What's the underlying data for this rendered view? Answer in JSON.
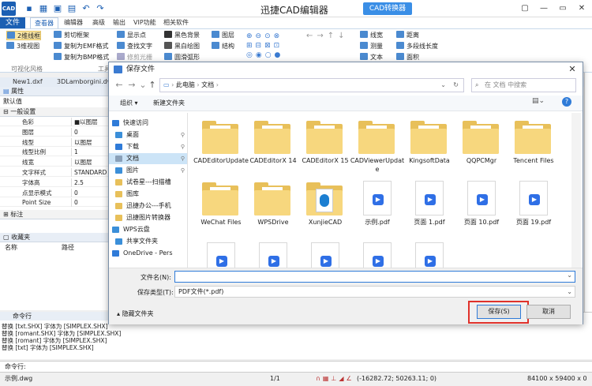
{
  "app": {
    "logo_text": "CAD",
    "title": "迅捷CAD编辑器",
    "convert_button": "CAD转换器",
    "window_controls": [
      "▢",
      "—",
      "▭",
      "✕"
    ]
  },
  "ribbon": {
    "tabs": [
      "文件",
      "查看器",
      "编辑器",
      "高级",
      "输出",
      "VIP功能",
      "相关软件"
    ],
    "active_tab": "查看器",
    "buttons": {
      "col1": [
        "2维线框",
        "3维视图"
      ],
      "col2": [
        "剪切框架",
        "复制为EMF格式",
        "复制为BMP格式"
      ],
      "col3": [
        "显示点",
        "查找文字",
        "修剪光栅"
      ],
      "col4": [
        "黑色背景",
        "黑白绘图",
        "圆滑弧形"
      ],
      "col5": [
        "图层",
        "结构"
      ],
      "col6": [
        "线宽",
        "测量",
        "文本"
      ],
      "col7": [
        "距离",
        "多段线长度",
        "面积"
      ]
    },
    "group_labels": [
      "可视化风格",
      "工具"
    ]
  },
  "doc_tabs": [
    "New1.dxf",
    "3DLamborgini.dwg"
  ],
  "properties": {
    "header": "属性",
    "default_value": "默认值",
    "section_general": "一般设置",
    "rows": [
      {
        "k": "色彩",
        "v": "■以图层"
      },
      {
        "k": "图层",
        "v": "0"
      },
      {
        "k": "线型",
        "v": "以图层"
      },
      {
        "k": "线型比例",
        "v": "1"
      },
      {
        "k": "线宽",
        "v": "以图层"
      },
      {
        "k": "文字样式",
        "v": "STANDARD"
      },
      {
        "k": "字体高",
        "v": "2.5"
      },
      {
        "k": "点显示模式",
        "v": "0"
      },
      {
        "k": "Point Size",
        "v": "0"
      }
    ],
    "section_annotation": "标注",
    "favorites_header": "收藏夹",
    "fav_cols": [
      "名称",
      "路径"
    ]
  },
  "command": {
    "header": "命令行",
    "lines": [
      "替换 [txt.SHX] 字体为 [SIMPLEX.SHX]",
      "替换 [romant.SHX] 字体为 [SIMPLEX.SHX]",
      "替换 [romant] 字体为 [SIMPLEX.SHX]",
      "替换 [txt] 字体为 [SIMPLEX.SHX]"
    ],
    "input_label": "命令行:"
  },
  "statusbar": {
    "file": "示例.dwg",
    "page": "1/1",
    "coords": "(-16282.72; 50263.11; 0)",
    "size": "84100 x 59400 x 0"
  },
  "dialog": {
    "title": "保存文件",
    "breadcrumb": [
      "此电脑",
      "文档"
    ],
    "search_placeholder": "在 文档 中搜索",
    "toolbar": {
      "organize": "组织 ▾",
      "new_folder": "新建文件夹"
    },
    "nav": [
      {
        "label": "快速访问",
        "icon": "star-icon",
        "color": "#2f7bd8",
        "indent": 0
      },
      {
        "label": "桌面",
        "icon": "desktop-icon",
        "color": "#3b8fd9",
        "indent": 1,
        "pin": true
      },
      {
        "label": "下载",
        "icon": "download-icon",
        "color": "#2f7bd8",
        "indent": 1,
        "pin": true
      },
      {
        "label": "文档",
        "icon": "documents-icon",
        "color": "#8aa0b8",
        "indent": 1,
        "pin": true,
        "selected": true
      },
      {
        "label": "图片",
        "icon": "pictures-icon",
        "color": "#3b8fd9",
        "indent": 1,
        "pin": true
      },
      {
        "label": "试卷星---扫描槽",
        "icon": "folder-icon",
        "color": "#e8c05a",
        "indent": 1
      },
      {
        "label": "图库",
        "icon": "folder-icon",
        "color": "#e8c05a",
        "indent": 1
      },
      {
        "label": "迅捷办公---手机",
        "icon": "folder-icon",
        "color": "#e8c05a",
        "indent": 1
      },
      {
        "label": "迅捷图片转换器",
        "icon": "folder-icon",
        "color": "#e8c05a",
        "indent": 1
      },
      {
        "label": "WPS云盘",
        "icon": "cloud-icon",
        "color": "#3b8fd9",
        "indent": 0
      },
      {
        "label": "共享文件夹",
        "icon": "shared-folder-icon",
        "color": "#3b8fd9",
        "indent": 1
      },
      {
        "label": "OneDrive - Pers",
        "icon": "onedrive-icon",
        "color": "#2f7bd8",
        "indent": 0
      }
    ],
    "files": [
      {
        "name": "CADEditorUpdate",
        "type": "folder"
      },
      {
        "name": "CADEditorX 14",
        "type": "folder"
      },
      {
        "name": "CADEditorX 15",
        "type": "folder"
      },
      {
        "name": "CADViewerUpdate",
        "type": "folder"
      },
      {
        "name": "KingsoftData",
        "type": "folder"
      },
      {
        "name": "QQPCMgr",
        "type": "folder"
      },
      {
        "name": "Tencent Files",
        "type": "folder"
      },
      {
        "name": "WeChat Files",
        "type": "folder"
      },
      {
        "name": "WPSDrive",
        "type": "folder"
      },
      {
        "name": "XunjieCAD",
        "type": "app"
      },
      {
        "name": "示例.pdf",
        "type": "pdf"
      },
      {
        "name": "页面 1.pdf",
        "type": "pdf"
      },
      {
        "name": "页面 10.pdf",
        "type": "pdf"
      },
      {
        "name": "页面 19.pdf",
        "type": "pdf"
      },
      {
        "name": "",
        "type": "pdf"
      },
      {
        "name": "",
        "type": "pdf"
      },
      {
        "name": "",
        "type": "pdf"
      },
      {
        "name": "",
        "type": "pdf"
      },
      {
        "name": "",
        "type": "pdf"
      }
    ],
    "filename_label": "文件名(N):",
    "filename_value": "",
    "filetype_label": "保存类型(T):",
    "filetype_value": "PDF文件(*.pdf)",
    "hide_folders": "隐藏文件夹",
    "save_button": "保存(S)",
    "cancel_button": "取消",
    "highlight_color": "#e0312a"
  }
}
